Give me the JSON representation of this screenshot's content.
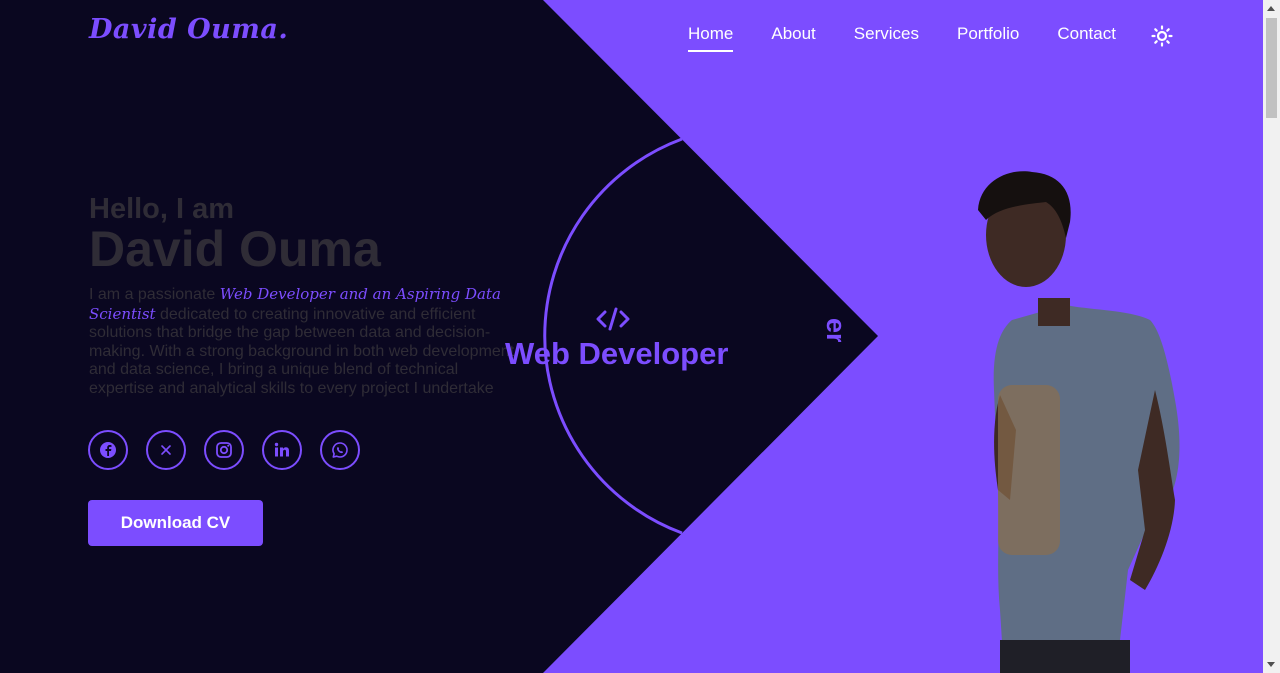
{
  "brand": {
    "logo_text": "David Ouma."
  },
  "nav": {
    "items": [
      {
        "label": "Home",
        "active": true
      },
      {
        "label": "About"
      },
      {
        "label": "Services"
      },
      {
        "label": "Portfolio"
      },
      {
        "label": "Contact"
      }
    ],
    "theme_toggle_icon": "sun-icon"
  },
  "hero": {
    "greeting": "Hello, I am",
    "name": "David Ouma",
    "bio_prefix": "I am a passionate ",
    "bio_highlight": "Web Developer and an Aspiring Data Scientist",
    "bio_suffix": " dedicated to creating innovative and efficient solutions that bridge the gap between data and decision-making. With a strong background in both web development and data science, I bring a unique blend of technical expertise and analytical skills to every project I undertake",
    "socials": [
      {
        "icon": "facebook-icon"
      },
      {
        "icon": "x-icon"
      },
      {
        "icon": "instagram-icon"
      },
      {
        "icon": "linkedin-icon"
      },
      {
        "icon": "whatsapp-icon"
      }
    ],
    "cv_button": "Download CV"
  },
  "roles": {
    "code_icon": "code-icon",
    "current": "Web Developer",
    "next_partial": "er"
  },
  "colors": {
    "accent": "#7c4dff",
    "background": "#0a0720",
    "text_muted": "#2f2c36"
  }
}
